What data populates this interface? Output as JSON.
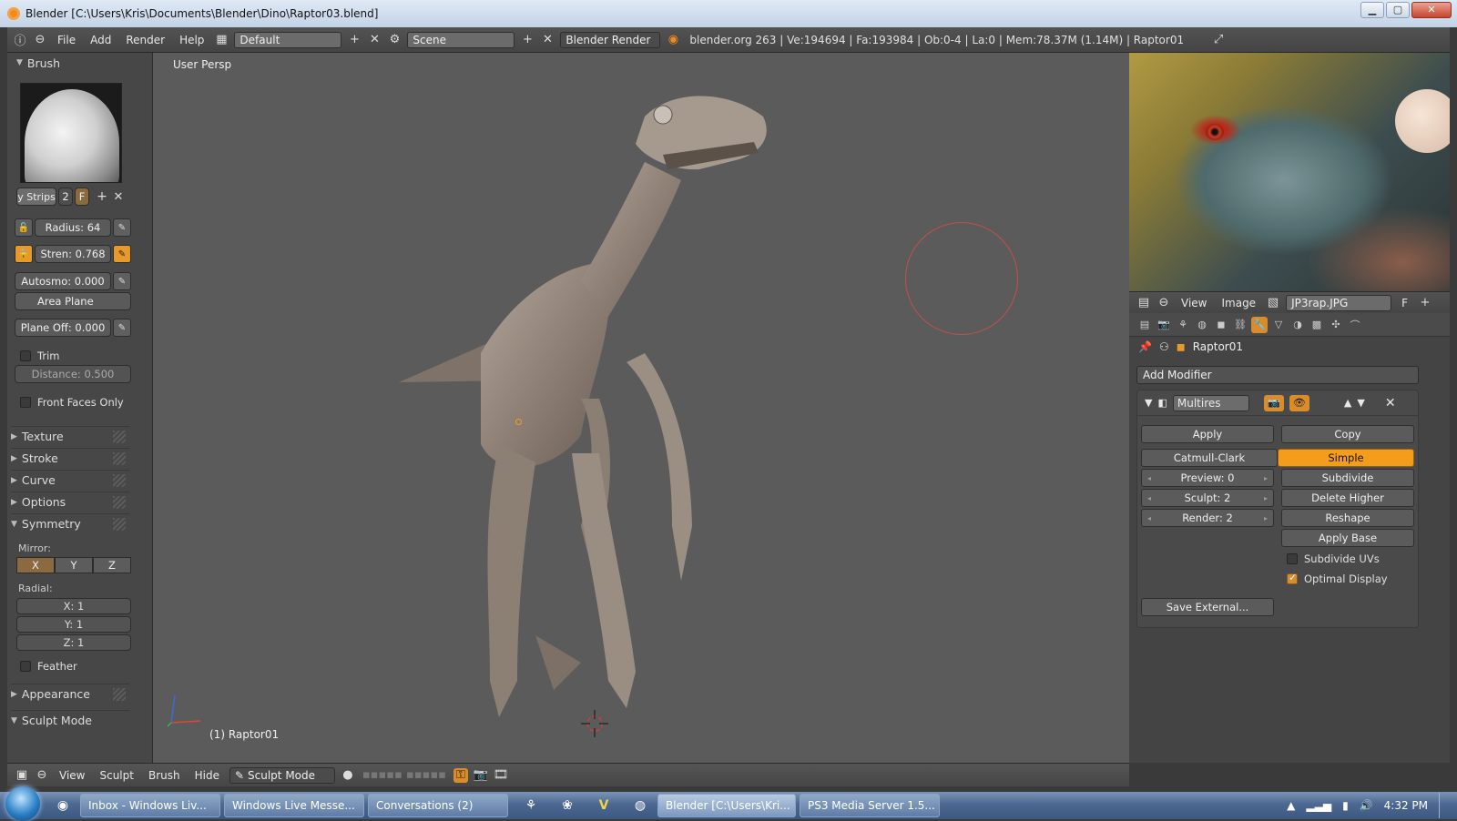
{
  "window": {
    "title": "Blender [C:\\Users\\Kris\\Documents\\Blender\\Dino\\Raptor03.blend]"
  },
  "info_header": {
    "menus": [
      "File",
      "Add",
      "Render",
      "Help"
    ],
    "screen_layout": "Default",
    "scene": "Scene",
    "render_engine": "Blender Render",
    "stats": "blender.org 263 | Ve:194694 | Fa:193984 | Ob:0-4 | La:0 | Mem:78.37M (1.14M) | Raptor01"
  },
  "toolshelf": {
    "brush_panel_title": "Brush",
    "brush_name": "y Strips",
    "brush_users": "2",
    "brush_fake": "F",
    "radius": "Radius: 64",
    "strength": "Stren: 0.768",
    "autosmooth": "Autosmo: 0.000",
    "area_plane": "Area Plane",
    "plane_offset": "Plane Off: 0.000",
    "trim_label": "Trim",
    "distance": "Distance: 0.500",
    "front_faces_label": "Front Faces Only",
    "collapsed_panels": [
      "Texture",
      "Stroke",
      "Curve",
      "Options"
    ],
    "symmetry_title": "Symmetry",
    "mirror_label": "Mirror:",
    "mirror_axes": [
      "X",
      "Y",
      "Z"
    ],
    "radial_label": "Radial:",
    "radial": [
      "X: 1",
      "Y: 1",
      "Z: 1"
    ],
    "feather_label": "Feather",
    "appearance_title": "Appearance",
    "sculpt_mode_title": "Sculpt Mode"
  },
  "viewport": {
    "view_label": "User Persp",
    "object_label": "(1) Raptor01"
  },
  "viewport_footer": {
    "menus": [
      "View",
      "Sculpt",
      "Brush",
      "Hide"
    ],
    "mode": "Sculpt Mode"
  },
  "image_editor": {
    "menus": [
      "View",
      "Image"
    ],
    "image_name": "JP3rap.JPG",
    "fake_user": "F"
  },
  "properties": {
    "object_name": "Raptor01",
    "add_modifier": "Add Modifier",
    "modifier_name": "Multires",
    "apply": "Apply",
    "copy": "Copy",
    "catmull": "Catmull-Clark",
    "simple": "Simple",
    "preview": "Preview: 0",
    "sculpt": "Sculpt: 2",
    "render": "Render: 2",
    "subdivide": "Subdivide",
    "delete_higher": "Delete Higher",
    "reshape": "Reshape",
    "apply_base": "Apply Base",
    "subdivide_uvs": "Subdivide UVs",
    "optimal_display": "Optimal Display",
    "save_external": "Save External..."
  },
  "taskbar": {
    "items": [
      "Inbox - Windows Liv...",
      "Windows Live Messe...",
      "Conversations (2)",
      "Blender [C:\\Users\\Kri...",
      "PS3 Media Server 1.5..."
    ],
    "clock": "4:32 PM"
  },
  "colors": {
    "accent": "#f49d1d",
    "panel_bg": "#474747",
    "viewport_bg": "#5b5b5b"
  }
}
